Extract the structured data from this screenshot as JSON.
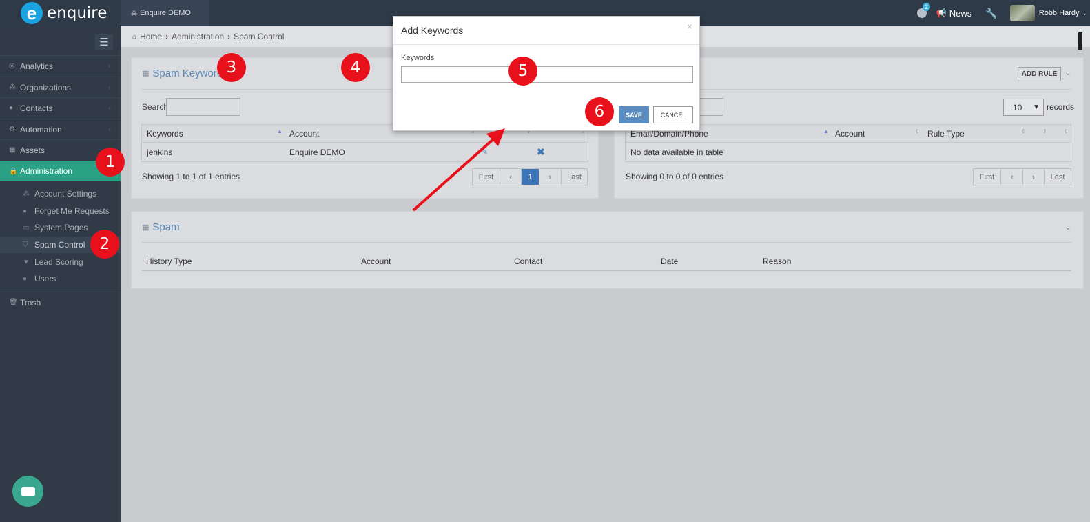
{
  "topbar": {
    "logo_text": "enquire",
    "org_tab": "Enquire DEMO",
    "notifications_count": "2",
    "news_label": "News",
    "user_name": "Robb Hardy"
  },
  "sidebar": {
    "items": [
      {
        "label": "Analytics"
      },
      {
        "label": "Organizations"
      },
      {
        "label": "Contacts"
      },
      {
        "label": "Automation"
      },
      {
        "label": "Assets"
      },
      {
        "label": "Administration"
      }
    ],
    "subitems": [
      {
        "label": "Account Settings"
      },
      {
        "label": "Forget Me Requests"
      },
      {
        "label": "System Pages"
      },
      {
        "label": "Spam Control"
      },
      {
        "label": "Lead Scoring"
      },
      {
        "label": "Users"
      }
    ],
    "trash_label": "Trash"
  },
  "breadcrumb": {
    "home": "Home",
    "admin": "Administration",
    "current": "Spam Control",
    "sep": "›"
  },
  "keywords_panel": {
    "title": "Spam Keyword",
    "search_label": "Search:",
    "columns": [
      "Keywords",
      "Account"
    ],
    "rows": [
      {
        "keyword": "jenkins",
        "account": "Enquire DEMO"
      }
    ],
    "info": "Showing 1 to 1 of 1 entries",
    "pager": {
      "first": "First",
      "prev": "‹",
      "page": "1",
      "next": "›",
      "last": "Last"
    }
  },
  "rules_panel": {
    "add_button": "ADD RULE",
    "page_size": "10",
    "records_label": "records",
    "columns": [
      "Email/Domain/Phone",
      "Account",
      "Rule Type"
    ],
    "empty_text": "No data available in table",
    "info": "Showing 0 to 0 of 0 entries",
    "pager": {
      "first": "First",
      "prev": "‹",
      "next": "›",
      "last": "Last"
    }
  },
  "spam_panel": {
    "title": "Spam",
    "columns": [
      "History Type",
      "Account",
      "Contact",
      "Date",
      "Reason"
    ]
  },
  "modal": {
    "title": "Add Keywords",
    "close": "×",
    "field_label": "Keywords",
    "field_value": "",
    "save_label": "SAVE",
    "cancel_label": "CANCEL"
  },
  "markers": [
    "1",
    "2",
    "3",
    "4",
    "5",
    "6"
  ],
  "colors": {
    "accent": "#2aa184",
    "link": "#5a8ab8",
    "marker": "#e8111b",
    "primary_button": "#5b8dc0"
  }
}
